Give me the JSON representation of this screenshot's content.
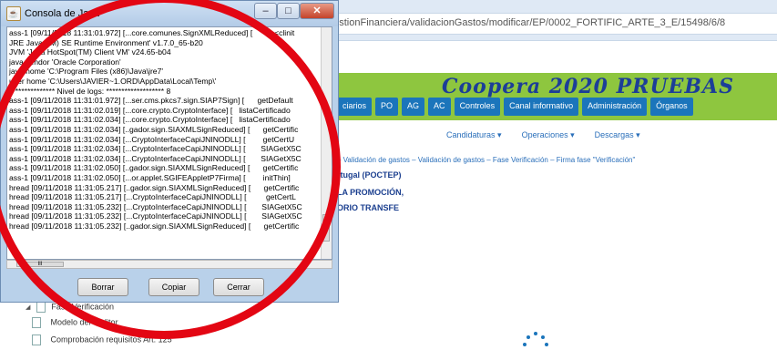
{
  "console": {
    "title": "Consola de Java",
    "icon": "java-cup-icon",
    "window_buttons": {
      "minimize": "–",
      "maximize": "□",
      "close": "✕"
    },
    "log_lines": [
      "ass-1 [09/11/2018 11:31:01.972] [...core.comunes.SignXMLReduced] [          <clinit",
      "JRE Java(TM) SE Runtime Environment' v1.7.0_65-b20",
      "JVM 'Java HotSpot(TM) Client VM' v24.65-b04",
      "java.vendor 'Oracle Corporation'",
      "java.home 'C:\\Program Files (x86)\\Java\\jre7'",
      "user home 'C:\\Users\\JAVIER~1.ORD\\AppData\\Local\\Temp\\'",
      "*************** Nivel de logs: ******************* 8",
      "ass-1 [09/11/2018 11:31:01.972] [...ser.cms.pkcs7.sign.SIAP7Sign] [      getDefault",
      "ass-1 [09/11/2018 11:31:02.019] [...core.crypto.CryptoInterface] [   listaCertificado",
      "ass-1 [09/11/2018 11:31:02.034] [...core.crypto.CryptoInterface] [   listaCertificado",
      "ass-1 [09/11/2018 11:31:02.034] [..gador.sign.SIAXMLSignReduced] [      getCertific",
      "ass-1 [09/11/2018 11:31:02.034] [...CryptoInterfaceCapiJNINODLL] [        getCertU",
      "ass-1 [09/11/2018 11:31:02.034] [...CryptoInterfaceCapiJNINODLL] [       SIAGetX5C",
      "ass-1 [09/11/2018 11:31:02.034] [...CryptoInterfaceCapiJNINODLL] [       SIAGetX5C",
      "ass-1 [09/11/2018 11:31:02.050] [..gador.sign.SIAXMLSignReduced] [      getCertific",
      "ass-1 [09/11/2018 11:31:02.050] [...or.applet.SGIFEAppletP7Firma] [        initThin]",
      "hread [09/11/2018 11:31:05.217] [..gador.sign.SIAXMLSignReduced] [      getCertific",
      "hread [09/11/2018 11:31:05.217] [...CryptoInterfaceCapiJNINODLL] [         getCertL",
      "hread [09/11/2018 11:31:05.232] [...CryptoInterfaceCapiJNINODLL] [       SIAGetX5C",
      "hread [09/11/2018 11:31:05.232] [...CryptoInterfaceCapiJNINODLL] [       SIAGetX5C",
      "hread [09/11/2018 11:31:05.232] [..gador.sign.SIAXMLSignReduced] [      getCertific"
    ],
    "hscroll_thumb": "III",
    "buttons": {
      "clear": "Borrar",
      "copy": "Copiar",
      "close": "Cerrar"
    }
  },
  "browser": {
    "url": "gestionFinanciera/validacionGastos/modificar/EP/0002_FORTIFIC_ARTE_3_E/15498/6/8",
    "banner_title": "Coopera 2020 PRUEBAS",
    "nav": [
      "ciarios",
      "PO",
      "AG",
      "AC",
      "Controles",
      "Canal informativo",
      "Administración",
      "Órganos"
    ],
    "submenu": [
      "Candidaturas ▾",
      "Operaciones ▾",
      "Descargas ▾"
    ],
    "breadcrumb": "– Validación de gastos – Validación de gastos – Fase Verificación – Firma fase \"Verificación\"",
    "links": [
      "rtugal (POCTEP)",
      "LA PROMOCIÓN,",
      "ORIO TRANSFE"
    ],
    "tree": {
      "expander": "◢",
      "phase": "Fase Verificación",
      "item1": "Modelo del auditor",
      "item2": "Comprobación requisitos Art. 125"
    }
  },
  "colors": {
    "annotation": "#e30613",
    "banner": "#8ec63f",
    "nav": "#1b75bb"
  }
}
